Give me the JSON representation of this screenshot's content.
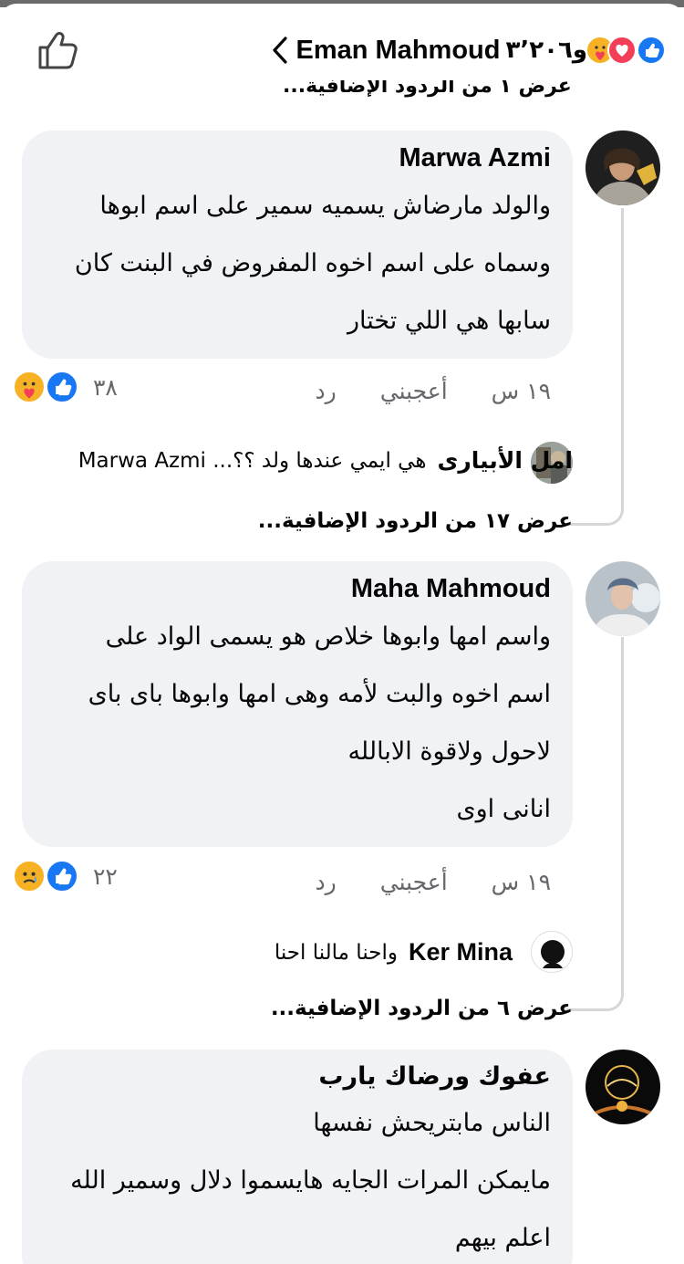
{
  "header": {
    "name": "Eman Mahmoud",
    "reaction_count": "و٣٬٢٠٦",
    "reactions": [
      "like-icon",
      "love-icon",
      "care-icon"
    ]
  },
  "cut_off_text": "عرض ١ من الردود الإضافية...",
  "comments": [
    {
      "author": "Marwa Azmi",
      "lines": [
        "والولد مارضاش يسميه سمير على اسم ابوها",
        "وسماه على اسم اخوه المفروض في البنت كان",
        "سابها هي اللي تختار"
      ],
      "time": "١٩ س",
      "like_label": "أعجبني",
      "reply_label": "رد",
      "reaction_count": "٣٨",
      "reactions": [
        "like-icon",
        "care-icon"
      ],
      "reply_preview": {
        "name": "امل الأبيارى",
        "text": "هي ايمي عندها ولد ؟؟... Marwa Azmi"
      },
      "more_replies": "عرض ١٧ من الردود الإضافية..."
    },
    {
      "author": "Maha Mahmoud",
      "lines": [
        "واسم امها وابوها خلاص هو يسمى الواد على",
        "اسم اخوه والبت لأمه وهى امها وابوها باى باى",
        "لاحول ولاقوة الابالله",
        "انانى اوى"
      ],
      "time": "١٩ س",
      "like_label": "أعجبني",
      "reply_label": "رد",
      "reaction_count": "٢٢",
      "reactions": [
        "like-icon",
        "sad-icon"
      ],
      "reply_preview": {
        "name": "Ker Mina",
        "text": "واحنا مالنا احنا"
      },
      "more_replies": "عرض ٦ من الردود الإضافية..."
    },
    {
      "author": "عفوك ورضاك يارب",
      "lines": [
        "الناس مابتريحش نفسها",
        "مايمكن المرات الجايه هايسموا دلال وسمير الله",
        "اعلم بيهم"
      ]
    }
  ],
  "colors": {
    "bubble": "#f0f2f5",
    "meta": "#65676b",
    "like_blue": "#1877f2",
    "love_red": "#f33e58",
    "care_yellow": "#f7b125"
  }
}
